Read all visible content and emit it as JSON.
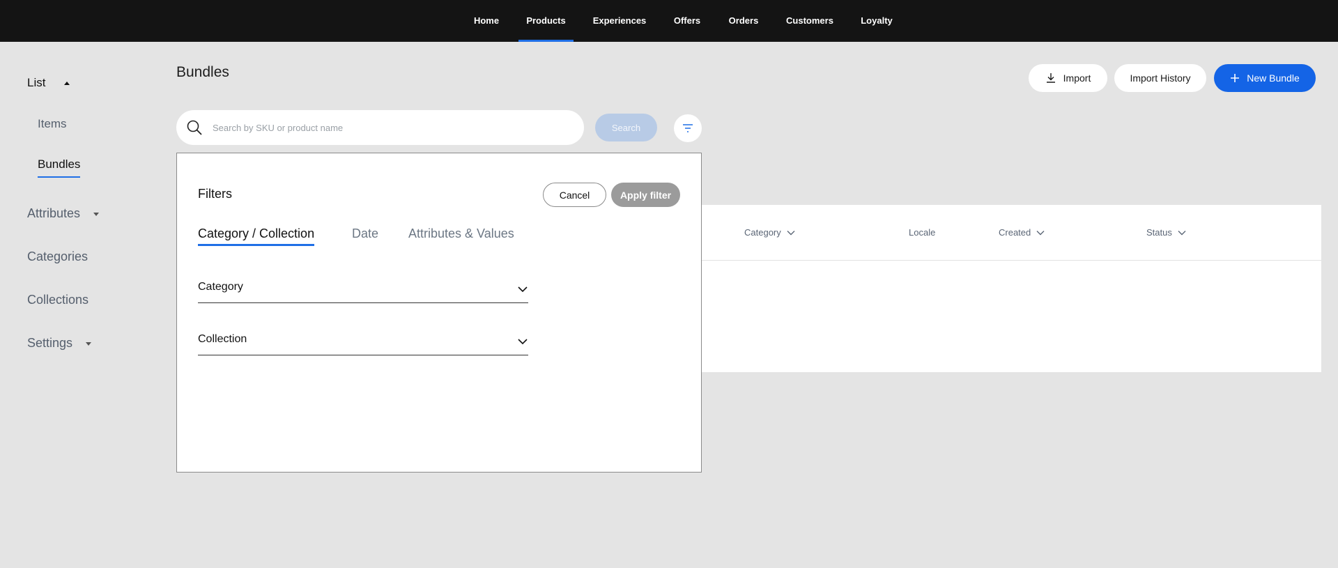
{
  "topnav": {
    "items": [
      "Home",
      "Products",
      "Experiences",
      "Offers",
      "Orders",
      "Customers",
      "Loyalty"
    ],
    "active": "Products"
  },
  "sidebar": {
    "list_label": "List",
    "items_label": "Items",
    "bundles_label": "Bundles",
    "attributes_label": "Attributes",
    "categories_label": "Categories",
    "collections_label": "Collections",
    "settings_label": "Settings"
  },
  "page": {
    "title": "Bundles"
  },
  "header_actions": {
    "import_label": "Import",
    "import_history_label": "Import History",
    "new_bundle_label": "New Bundle"
  },
  "search": {
    "placeholder": "Search by SKU or product name",
    "button_label": "Search"
  },
  "table": {
    "columns": [
      "Category",
      "Locale",
      "Created",
      "Status"
    ]
  },
  "filters": {
    "title": "Filters",
    "cancel_label": "Cancel",
    "apply_label": "Apply filter",
    "tabs": [
      "Category / Collection",
      "Date",
      "Attributes & Values"
    ],
    "active_tab": "Category / Collection",
    "category_label": "Category",
    "collection_label": "Collection"
  },
  "colors": {
    "accent": "#1464e6",
    "topbar": "#141414",
    "background": "#e4e4e4"
  }
}
